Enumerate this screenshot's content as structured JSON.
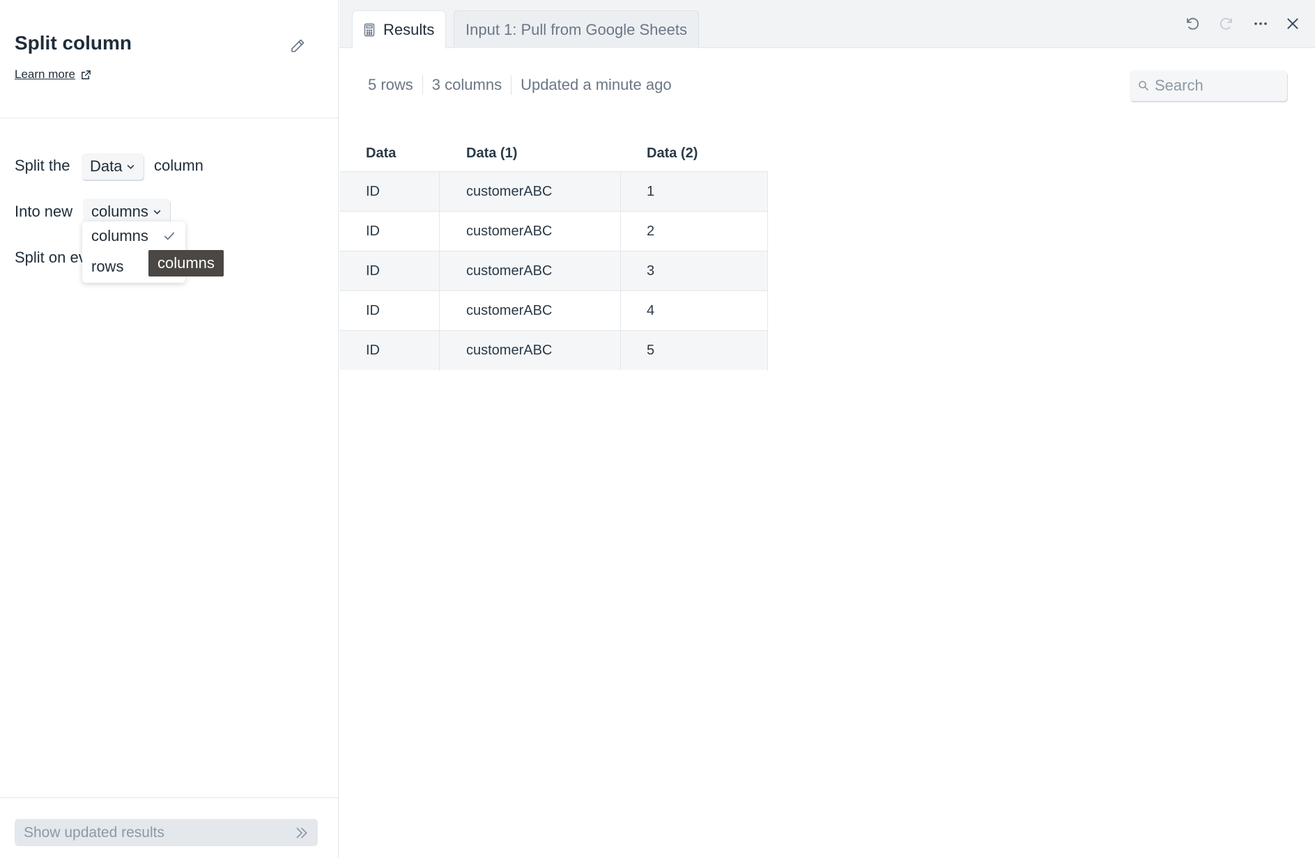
{
  "left_panel": {
    "title": "Split column",
    "learn_more": "Learn more",
    "split_the_label": "Split the",
    "split_column_value": "Data",
    "column_suffix": "column",
    "into_new_label": "Into new",
    "into_new_value": "columns",
    "split_on_label": "Split on ev",
    "dropdown_options": [
      {
        "label": "columns",
        "selected": true
      },
      {
        "label": "rows",
        "selected": false
      }
    ],
    "tooltip": "columns",
    "show_button": "Show updated results"
  },
  "tabs": [
    {
      "label": "Results",
      "active": true,
      "icon": "calculator-icon"
    },
    {
      "label": "Input 1: Pull from Google Sheets",
      "active": false
    }
  ],
  "toolbar": {
    "icons": [
      "undo-icon",
      "redo-icon",
      "more-icon",
      "close-icon"
    ]
  },
  "meta": {
    "rows": "5 rows",
    "columns": "3 columns",
    "updated": "Updated a minute ago"
  },
  "search": {
    "placeholder": "Search"
  },
  "table": {
    "headers": [
      "Data",
      "Data (1)",
      "Data (2)"
    ],
    "rows": [
      [
        "ID",
        "customerABC",
        "1"
      ],
      [
        "ID",
        "customerABC",
        "2"
      ],
      [
        "ID",
        "customerABC",
        "3"
      ],
      [
        "ID",
        "customerABC",
        "4"
      ],
      [
        "ID",
        "customerABC",
        "5"
      ]
    ]
  },
  "colors": {
    "text": "#1f2d3a",
    "muted": "#6b7785",
    "border": "#e3e7eb",
    "row_shade": "#f4f6f8",
    "tooltip_bg": "#4a4744"
  }
}
